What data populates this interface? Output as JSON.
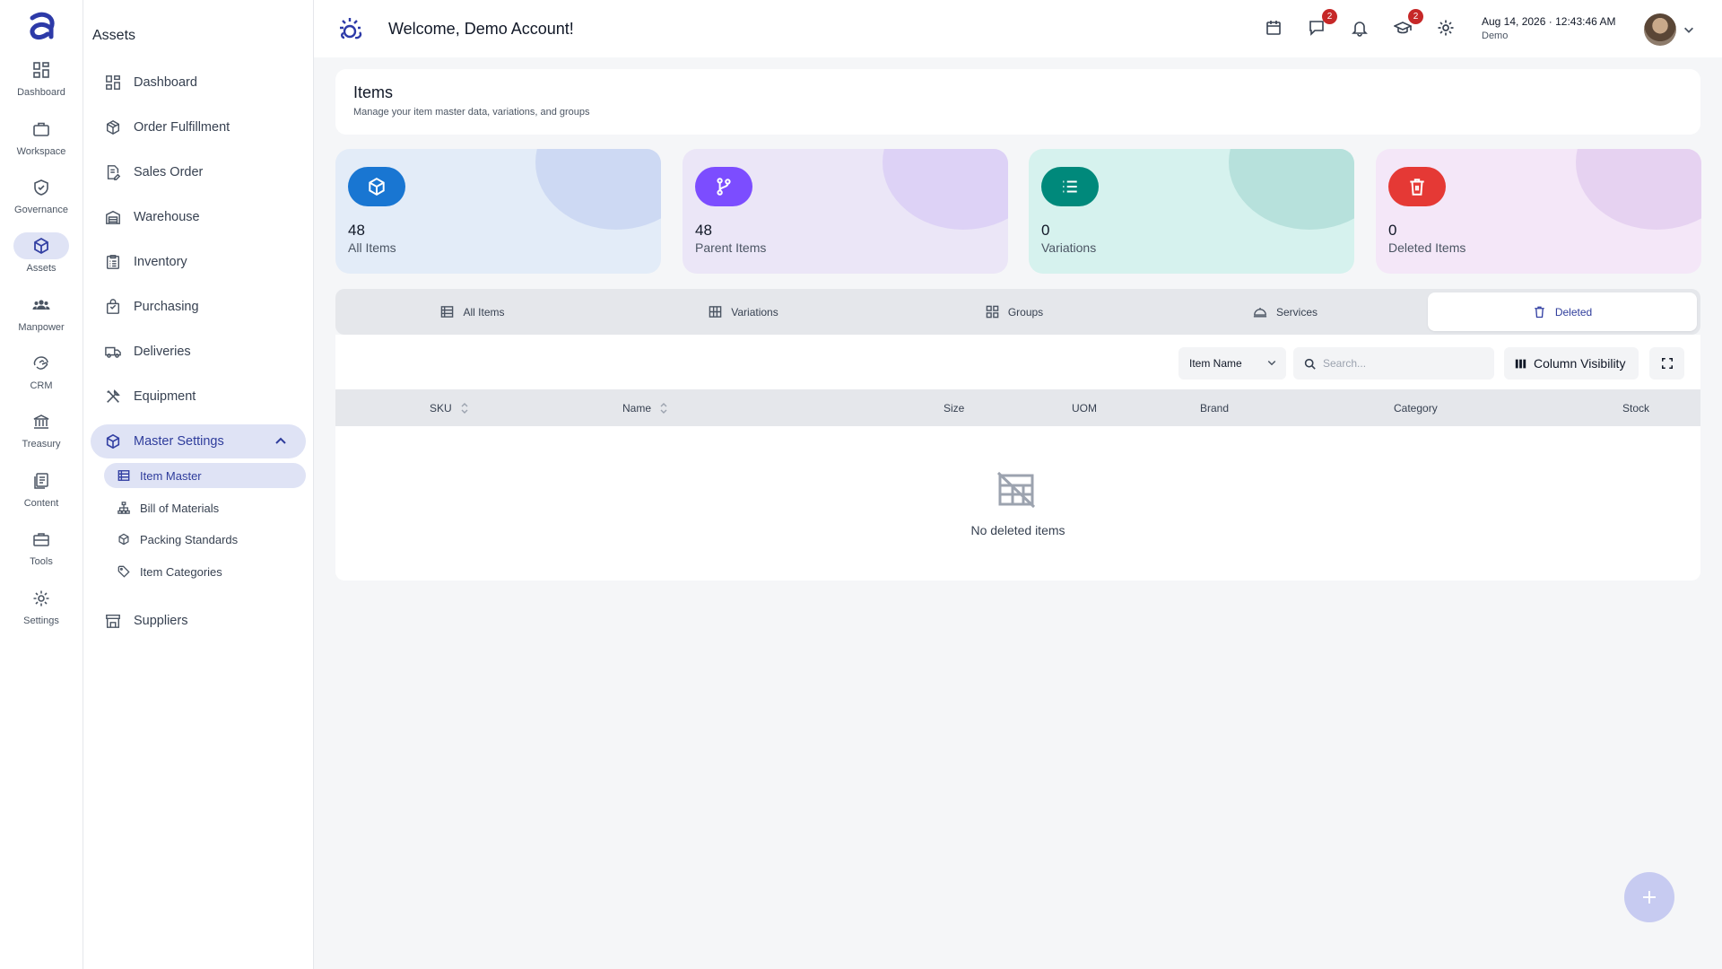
{
  "rail": {
    "items": [
      {
        "label": "Dashboard",
        "icon": "grid-icon"
      },
      {
        "label": "Workspace",
        "icon": "briefcase-icon"
      },
      {
        "label": "Governance",
        "icon": "shield-check-icon"
      },
      {
        "label": "Assets",
        "icon": "cube-icon"
      },
      {
        "label": "Manpower",
        "icon": "people-icon"
      },
      {
        "label": "CRM",
        "icon": "handshake-icon"
      },
      {
        "label": "Treasury",
        "icon": "bank-icon"
      },
      {
        "label": "Content",
        "icon": "document-icon"
      },
      {
        "label": "Tools",
        "icon": "toolbox-icon"
      },
      {
        "label": "Settings",
        "icon": "gear-icon"
      }
    ],
    "active": "Assets"
  },
  "sidebar": {
    "title": "Assets",
    "items": [
      {
        "label": "Dashboard"
      },
      {
        "label": "Order Fulfillment"
      },
      {
        "label": "Sales Order"
      },
      {
        "label": "Warehouse"
      },
      {
        "label": "Inventory"
      },
      {
        "label": "Purchasing"
      },
      {
        "label": "Deliveries"
      },
      {
        "label": "Equipment"
      },
      {
        "label": "Master Settings"
      },
      {
        "label": "Suppliers"
      }
    ],
    "sub_items": [
      {
        "label": "Item Master"
      },
      {
        "label": "Bill of Materials"
      },
      {
        "label": "Packing Standards"
      },
      {
        "label": "Item Categories"
      }
    ]
  },
  "topbar": {
    "welcome": "Welcome, Demo Account!",
    "messages_badge": "2",
    "academy_badge": "2",
    "date": "Aug 14, 2026",
    "separator": "·",
    "time": "12:43:46 AM",
    "user": "Demo"
  },
  "page": {
    "title": "Items",
    "subtitle": "Manage your item master data, variations, and groups"
  },
  "stats": [
    {
      "value": "48",
      "label": "All Items",
      "color": "#1976d2",
      "bg": "#e3ecf8",
      "deco": "#cdd9f3"
    },
    {
      "value": "48",
      "label": "Parent Items",
      "color": "#7c4dff",
      "bg": "#ebe6f7",
      "deco": "#ddd2f6"
    },
    {
      "value": "0",
      "label": "Variations",
      "color": "#00897b",
      "bg": "#d6f2ee",
      "deco": "#b7e1dc"
    },
    {
      "value": "0",
      "label": "Deleted Items",
      "color": "#e53935",
      "bg": "#f4e7f8",
      "deco": "#e6d2f1"
    }
  ],
  "tabs": [
    {
      "label": "All Items"
    },
    {
      "label": "Variations"
    },
    {
      "label": "Groups"
    },
    {
      "label": "Services"
    },
    {
      "label": "Deleted"
    }
  ],
  "table": {
    "filter_field": "Item Name",
    "search_placeholder": "Search...",
    "column_visibility": "Column Visibility",
    "columns": [
      "SKU",
      "Name",
      "Size",
      "UOM",
      "Brand",
      "Category",
      "Stock"
    ],
    "empty_text": "No deleted items"
  }
}
